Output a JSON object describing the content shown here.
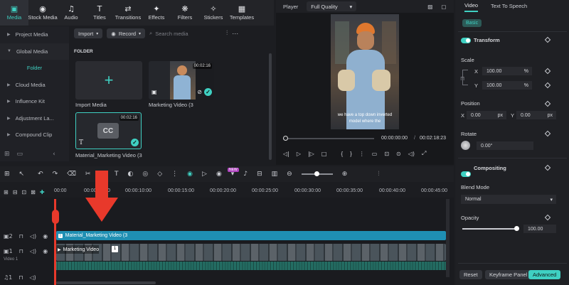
{
  "toolbar": {
    "items": [
      {
        "label": "Media",
        "icon": "media-icon",
        "glyph": "▣"
      },
      {
        "label": "Stock Media",
        "icon": "stock-media-icon",
        "glyph": "◉"
      },
      {
        "label": "Audio",
        "icon": "audio-icon",
        "glyph": "♫"
      },
      {
        "label": "Titles",
        "icon": "titles-icon",
        "glyph": "T"
      },
      {
        "label": "Transitions",
        "icon": "transitions-icon",
        "glyph": "⇄"
      },
      {
        "label": "Effects",
        "icon": "effects-icon",
        "glyph": "✦"
      },
      {
        "label": "Filters",
        "icon": "filters-icon",
        "glyph": "❋"
      },
      {
        "label": "Stickers",
        "icon": "stickers-icon",
        "glyph": "✧"
      },
      {
        "label": "Templates",
        "icon": "templates-icon",
        "glyph": "▦"
      }
    ]
  },
  "nav": {
    "items": [
      "Project Media",
      "Global Media",
      "Folder",
      "Cloud Media",
      "Influence Kit",
      "Adjustment La...",
      "Compound Clip"
    ]
  },
  "media": {
    "import_label": "Import",
    "record_label": "Record",
    "search_placeholder": "Search media",
    "folder_label": "FOLDER",
    "cards": [
      {
        "label": "Import Media"
      },
      {
        "label": "Marketing Video (3",
        "duration": "00:02:16"
      },
      {
        "label": "Material_Marketing Video (3",
        "duration": "00:02:16",
        "thumb_text": "CC"
      }
    ]
  },
  "player": {
    "label": "Player",
    "quality": "Full Quality",
    "subtitle_line1": "we have a top down inverted",
    "subtitle_line2": "model where the",
    "current_time": "00:00:00:00",
    "total_time": "00:02:18:23"
  },
  "inspector": {
    "tabs": [
      "Video",
      "Text To Speech"
    ],
    "basic_label": "Basic",
    "transform_label": "Transform",
    "scale_label": "Scale",
    "scale_x": "100.00",
    "scale_y": "100.00",
    "percent": "%",
    "position_label": "Position",
    "pos_x": "0.00",
    "pos_y": "0.00",
    "px": "px",
    "rotate_label": "Rotate",
    "rotate_value": "0.00°",
    "compositing_label": "Compositing",
    "blend_mode_label": "Blend Mode",
    "blend_mode_value": "Normal",
    "opacity_label": "Opacity",
    "opacity_value": "100.00",
    "reset_label": "Reset",
    "keyframe_label": "Keyframe Panel",
    "advanced_label": "Advanced",
    "x_label": "X",
    "y_label": "Y"
  },
  "timeline": {
    "ticks": [
      "00:00",
      "00:00:05:00",
      "00:00:10:00",
      "00:00:15:00",
      "00:00:20:00",
      "00:00:25:00",
      "00:00:30:00",
      "00:00:35:00",
      "00:00:40:00",
      "00:00:45:00"
    ],
    "track2_label": "2",
    "track1_label": "1",
    "video_track_name": "Video 1",
    "audio_label": "1",
    "title_clip": "Material_Marketing Video (3",
    "video_clip": "Marketing Video",
    "badge": "1"
  },
  "colors": {
    "accent": "#3fd0c2",
    "arrow": "#e8392b",
    "title_clip": "#1f8fb3",
    "video_clip": "#3d4a52",
    "audio_wave": "#2a8a7c"
  }
}
